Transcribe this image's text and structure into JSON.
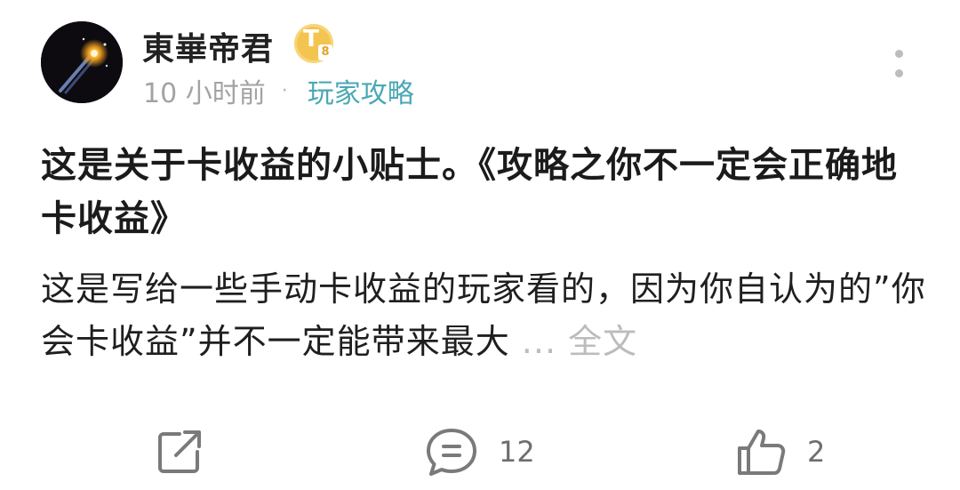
{
  "author": {
    "name": "東崋帝君",
    "badge_letter": "T",
    "badge_level": "8"
  },
  "meta": {
    "time": "10 小时前",
    "separator": "·",
    "category": "玩家攻略"
  },
  "post": {
    "title": "这是关于卡收益的小贴士。《攻略之你不一定会正确地卡收益》",
    "body": "这是写给一些手动卡收益的玩家看的，因为你自认为的”你会卡收益”并不一定能带来最大",
    "ellipsis": "...",
    "read_more": "全文"
  },
  "actions": {
    "share_icon": "share-icon",
    "comment_icon": "comment-icon",
    "comment_count": "12",
    "like_icon": "thumbs-up-icon",
    "like_count": "2"
  },
  "colors": {
    "category": "#4aa8b4",
    "badge": "#f4c451",
    "muted": "#a3a3a3"
  }
}
